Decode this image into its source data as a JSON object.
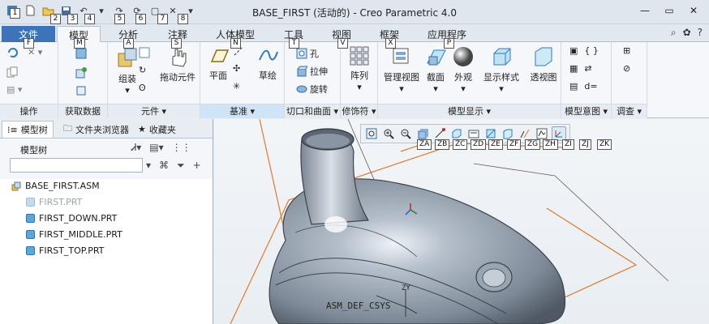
{
  "window": {
    "title": "BASE_FIRST (活动的) - Creo Parametric 4.0"
  },
  "quick_access": {
    "keytips": [
      "1",
      "2",
      "3",
      "4",
      "5",
      "6",
      "7",
      "8"
    ]
  },
  "tabs": [
    {
      "label": "文件",
      "keytip": "F"
    },
    {
      "label": "模型",
      "keytip": "M"
    },
    {
      "label": "分析",
      "keytip": "A"
    },
    {
      "label": "注释",
      "keytip": "S"
    },
    {
      "label": "人体模型",
      "keytip": "N"
    },
    {
      "label": "工具",
      "keytip": "T"
    },
    {
      "label": "视图",
      "keytip": "V"
    },
    {
      "label": "框架",
      "keytip": "X"
    },
    {
      "label": "应用程序",
      "keytip": "P"
    }
  ],
  "ribbon": {
    "groups": [
      {
        "label": "操作"
      },
      {
        "label": "获取数据"
      },
      {
        "label": "元件"
      },
      {
        "label": "基准"
      },
      {
        "label": "切口和曲面"
      },
      {
        "label": "修饰符"
      },
      {
        "label": "模型显示"
      },
      {
        "label": "模型意图"
      },
      {
        "label": "调查"
      }
    ],
    "buttons": {
      "assemble": "组装",
      "drag": "拖动元件",
      "plane": "平面",
      "sketch": "草绘",
      "hole": "孔",
      "extrude": "拉伸",
      "revolve": "旋转",
      "pattern": "阵列",
      "manage_views": "管理视图",
      "section": "截面",
      "appearance": "外观",
      "display_style": "显示样式",
      "perspective": "透视图",
      "relations": "d="
    }
  },
  "left_panel": {
    "tabs": [
      "模型树",
      "文件夹浏览器",
      "收藏夹"
    ],
    "heading": "模型树",
    "search_placeholder": "",
    "tree": [
      {
        "label": "BASE_FIRST.ASM",
        "state": "normal"
      },
      {
        "label": "FIRST.PRT",
        "state": "dim"
      },
      {
        "label": "FIRST_DOWN.PRT",
        "state": "normal"
      },
      {
        "label": "FIRST_MIDDLE.PRT",
        "state": "normal"
      },
      {
        "label": "FIRST_TOP.PRT",
        "state": "normal"
      }
    ]
  },
  "viewport": {
    "keytips": [
      "ZA",
      "ZB",
      "ZC",
      "ZD",
      "ZE",
      "ZF",
      "ZG",
      "ZH",
      "ZI",
      "ZJ",
      "ZK"
    ],
    "csys_label": "ASM_DEF_CSYS",
    "axis_label": "ZY"
  },
  "colors": {
    "file_tab": "#3d73b8",
    "datum_orange": "#e07a2a",
    "model_body": "#8f9bab"
  }
}
